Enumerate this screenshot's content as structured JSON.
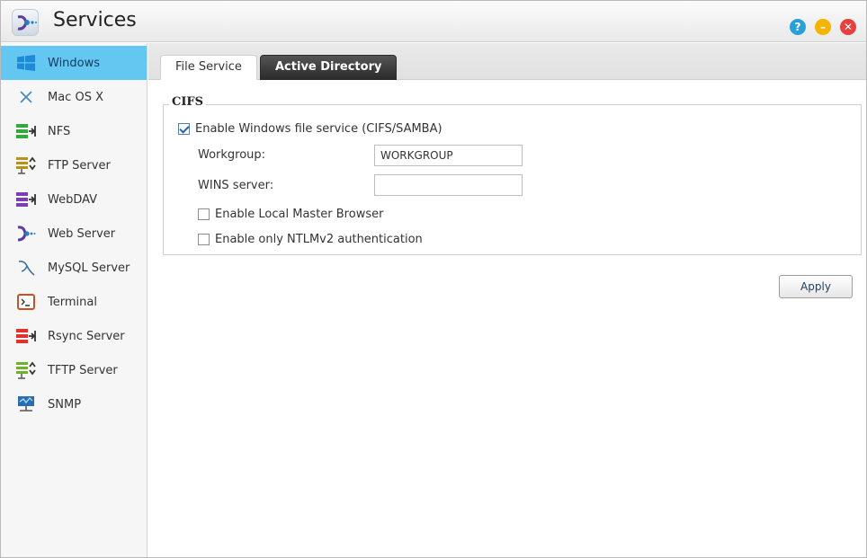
{
  "window": {
    "title": "Services",
    "controls": {
      "help": "?",
      "minimize": "–",
      "close": "✕"
    }
  },
  "sidebar": {
    "items": [
      {
        "label": "Windows",
        "icon": "windows-icon",
        "active": true
      },
      {
        "label": "Mac OS X",
        "icon": "mac-x-icon"
      },
      {
        "label": "NFS",
        "icon": "nfs-icon"
      },
      {
        "label": "FTP Server",
        "icon": "ftp-server-icon"
      },
      {
        "label": "WebDAV",
        "icon": "webdav-icon"
      },
      {
        "label": "Web Server",
        "icon": "web-server-icon"
      },
      {
        "label": "MySQL Server",
        "icon": "mysql-dolphin-icon"
      },
      {
        "label": "Terminal",
        "icon": "terminal-icon"
      },
      {
        "label": "Rsync Server",
        "icon": "rsync-server-icon"
      },
      {
        "label": "TFTP Server",
        "icon": "tftp-server-icon"
      },
      {
        "label": "SNMP",
        "icon": "snmp-icon"
      }
    ]
  },
  "tabs": {
    "file_service": "File Service",
    "active_directory": "Active Directory",
    "selected": "File Service"
  },
  "cifs": {
    "legend": "CIFS",
    "enable_label": "Enable Windows file service (CIFS/SAMBA)",
    "enable_checked": true,
    "workgroup_label": "Workgroup:",
    "workgroup_value": "WORKGROUP",
    "wins_label": "WINS server:",
    "wins_value": "",
    "local_master_label": "Enable Local Master Browser",
    "local_master_checked": false,
    "ntlmv2_label": "Enable only NTLMv2 authentication",
    "ntlmv2_checked": false
  },
  "actions": {
    "apply_label": "Apply"
  },
  "colors": {
    "sidebar_active": "#63c7f2",
    "help": "#2aa0d8",
    "minimize": "#f5b400",
    "close": "#ea3f3f",
    "tab_dark": "#2b2b2b"
  }
}
